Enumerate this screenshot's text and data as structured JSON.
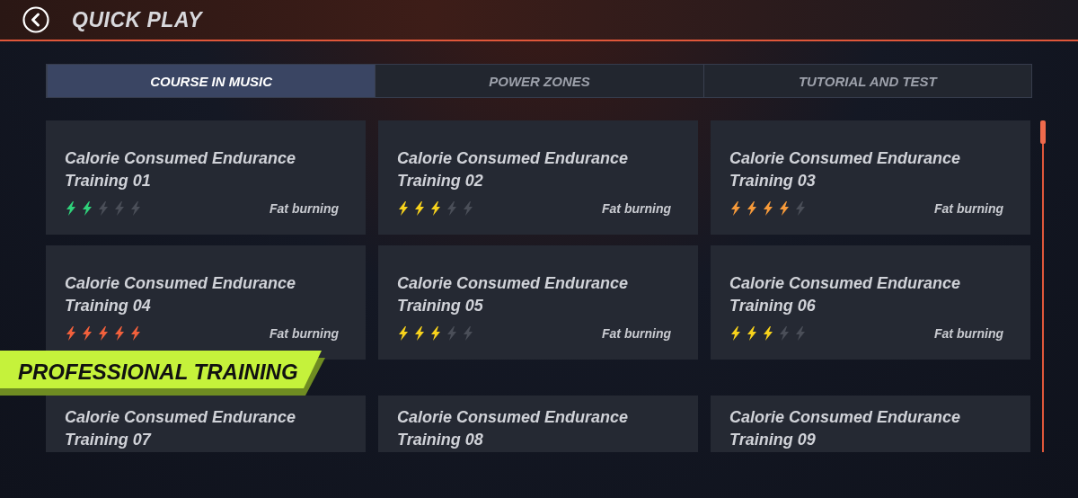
{
  "header": {
    "title": "QUICK PLAY"
  },
  "tabs": [
    {
      "label": "COURSE IN MUSIC",
      "selected": true
    },
    {
      "label": "POWER ZONES",
      "selected": false
    },
    {
      "label": "TUTORIAL AND TEST",
      "selected": false
    }
  ],
  "cards": [
    {
      "title": "Calorie Consumed Endurance Training 01",
      "stars": 2,
      "color": "#2fd17a",
      "tag": "Fat burning"
    },
    {
      "title": "Calorie Consumed Endurance Training 02",
      "stars": 3,
      "color": "#f7d21c",
      "tag": "Fat burning"
    },
    {
      "title": "Calorie Consumed Endurance Training 03",
      "stars": 4,
      "color": "#f79a3a",
      "tag": "Fat burning"
    },
    {
      "title": "Calorie Consumed Endurance Training 04",
      "stars": 5,
      "color": "#f2603c",
      "tag": "Fat burning"
    },
    {
      "title": "Calorie Consumed Endurance Training 05",
      "stars": 3,
      "color": "#f7d21c",
      "tag": "Fat burning"
    },
    {
      "title": "Calorie Consumed Endurance Training 06",
      "stars": 3,
      "color": "#f7d21c",
      "tag": "Fat burning"
    },
    {
      "title": "Calorie Consumed Endurance Training 07"
    },
    {
      "title": "Calorie Consumed Endurance Training 08"
    },
    {
      "title": "Calorie Consumed Endurance Training 09"
    }
  ],
  "banner": {
    "label": "PROFESSIONAL TRAINING"
  }
}
